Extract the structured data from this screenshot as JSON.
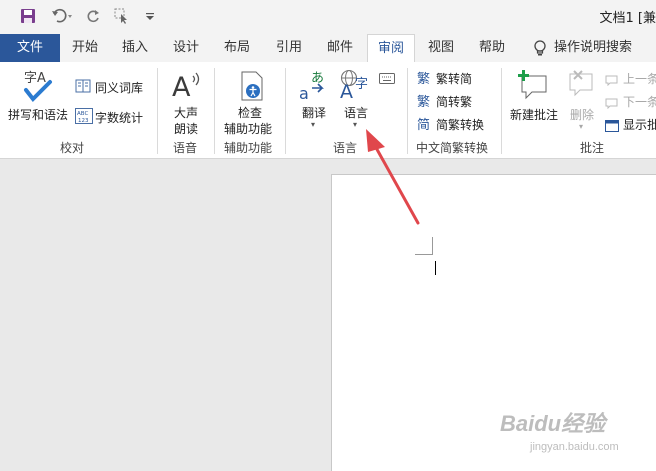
{
  "titlebar": {
    "doc_title": "文档1 [兼"
  },
  "tabs": [
    {
      "label": "文件"
    },
    {
      "label": "开始"
    },
    {
      "label": "插入"
    },
    {
      "label": "设计"
    },
    {
      "label": "布局"
    },
    {
      "label": "引用"
    },
    {
      "label": "邮件"
    },
    {
      "label": "审阅"
    },
    {
      "label": "视图"
    },
    {
      "label": "帮助"
    }
  ],
  "tell_me": "操作说明搜索",
  "ribbon": {
    "proofing": {
      "spelling": "拼写和语法",
      "thesaurus": "同义词库",
      "word_count": "字数统计",
      "group_label": "校对"
    },
    "speech": {
      "read_aloud_line1": "大声",
      "read_aloud_line2": "朗读",
      "group_label": "语音"
    },
    "accessibility": {
      "check_line1": "检查",
      "check_line2": "辅助功能",
      "group_label": "辅助功能"
    },
    "language": {
      "translate": "翻译",
      "language": "语言",
      "group_label": "语言"
    },
    "chinese": {
      "trad_to_simp": "繁转简",
      "simp_to_trad": "简转繁",
      "convert": "简繁转换",
      "group_label": "中文简繁转换"
    },
    "comments": {
      "new_comment": "新建批注",
      "delete": "删除",
      "previous": "上一条",
      "next": "下一条",
      "show": "显示批",
      "group_label": "批注"
    }
  },
  "icons": {
    "spelling_big": "字A",
    "read_aloud_big": "A",
    "lang_big": "A字",
    "abc123": "ABC 123"
  },
  "watermark": {
    "brand": "Baidu经验",
    "url": "jingyan.baidu.com"
  },
  "colors": {
    "file_tab": "#2b579a",
    "accent": "#2b579a",
    "arrow": "#e0474c"
  }
}
